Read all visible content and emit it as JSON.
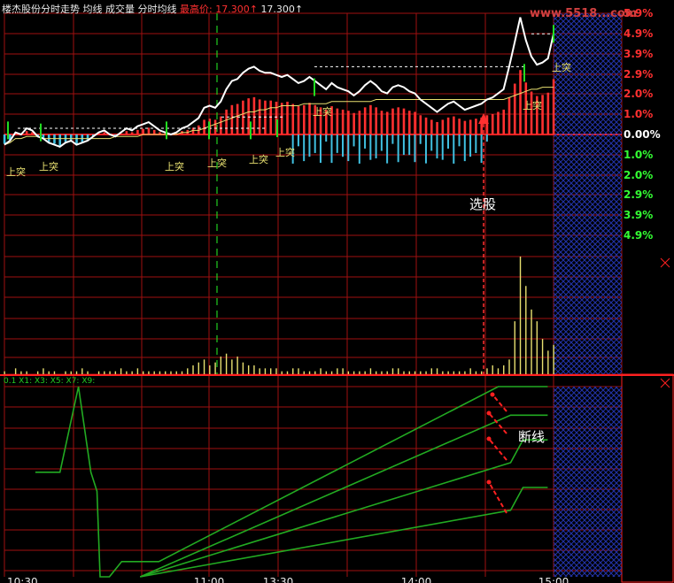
{
  "header": {
    "stock_name": "楼杰股份",
    "chart_title": "分时走势",
    "indicators": [
      "均线",
      "成交量",
      "分时均线"
    ],
    "high_label": "最高价:",
    "high_value": "17.300↑",
    "high_value2": "17.300↑"
  },
  "logo": {
    "text": "www.5518...com"
  },
  "sub_header": {
    "text": "0.1 X1: X3: X5: X7: X9:"
  },
  "annotations": {
    "select_stock": "选股",
    "break_line": "断线",
    "breakout": "上突"
  },
  "colors": {
    "background": "#000000",
    "grid": "#a01010",
    "price": "#ffffff",
    "avg": "#e8e070",
    "up": "#ff3030",
    "down": "#40c0e0",
    "indicator": "#22aa22",
    "volume": "#e8e070",
    "hatch": "#1a2a8a"
  },
  "chart_data": [
    {
      "type": "line",
      "name": "intraday-price",
      "y_ticks_up": [
        "5.9%",
        "4.9%",
        "3.9%",
        "2.9%",
        "2.0%",
        "1.0%"
      ],
      "y_tick_zero": "0.00%",
      "y_ticks_down": [
        "1.0%",
        "2.0%",
        "2.9%",
        "3.9%",
        "4.9%"
      ],
      "ylim": [
        -4.9,
        5.9
      ],
      "price_pct": [
        -0.5,
        -0.3,
        0.1,
        0.0,
        0.3,
        0.2,
        -0.1,
        -0.2,
        -0.4,
        -0.5,
        -0.6,
        -0.4,
        -0.3,
        -0.5,
        -0.4,
        -0.3,
        -0.1,
        0.1,
        0.2,
        0.0,
        -0.1,
        0.1,
        0.3,
        0.2,
        0.4,
        0.5,
        0.6,
        0.4,
        0.2,
        0.1,
        0.0,
        0.1,
        0.3,
        0.4,
        0.6,
        0.8,
        1.3,
        1.4,
        1.3,
        1.6,
        2.2,
        2.6,
        2.7,
        3.0,
        3.2,
        3.3,
        3.1,
        3.0,
        3.0,
        2.9,
        2.8,
        2.9,
        2.7,
        2.5,
        2.6,
        2.8,
        2.6,
        2.4,
        2.2,
        2.5,
        2.3,
        2.2,
        2.1,
        1.9,
        2.1,
        2.4,
        2.6,
        2.4,
        2.1,
        2.0,
        2.3,
        2.4,
        2.3,
        2.1,
        2.0,
        1.7,
        1.5,
        1.3,
        1.1,
        1.3,
        1.5,
        1.6,
        1.4,
        1.2,
        1.3,
        1.4,
        1.5,
        1.7,
        1.8,
        2.0,
        2.2,
        3.3,
        4.5,
        5.7,
        4.6,
        3.8,
        3.4,
        3.5,
        3.7,
        4.9
      ],
      "avg_pct": [
        -0.5,
        -0.4,
        -0.2,
        -0.2,
        -0.1,
        -0.1,
        -0.1,
        -0.2,
        -0.2,
        -0.2,
        -0.2,
        -0.2,
        -0.2,
        -0.2,
        -0.2,
        -0.2,
        -0.2,
        -0.2,
        -0.2,
        -0.2,
        -0.1,
        -0.1,
        -0.1,
        -0.1,
        -0.1,
        0.0,
        0.0,
        0.0,
        0.0,
        0.0,
        0.0,
        0.0,
        0.1,
        0.1,
        0.2,
        0.2,
        0.3,
        0.4,
        0.5,
        0.6,
        0.7,
        0.8,
        0.9,
        1.0,
        1.1,
        1.1,
        1.2,
        1.2,
        1.3,
        1.3,
        1.4,
        1.4,
        1.4,
        1.4,
        1.5,
        1.5,
        1.5,
        1.5,
        1.5,
        1.6,
        1.6,
        1.6,
        1.6,
        1.6,
        1.6,
        1.6,
        1.6,
        1.7,
        1.7,
        1.7,
        1.7,
        1.7,
        1.7,
        1.7,
        1.7,
        1.7,
        1.7,
        1.7,
        1.7,
        1.7,
        1.7,
        1.7,
        1.7,
        1.7,
        1.7,
        1.7,
        1.7,
        1.7,
        1.7,
        1.7,
        1.7,
        1.8,
        1.9,
        2.0,
        2.1,
        2.2,
        2.2,
        2.3,
        2.3,
        2.3
      ]
    },
    {
      "type": "bar",
      "name": "volume",
      "values": [
        1,
        0,
        2,
        1,
        1,
        0,
        1,
        2,
        1,
        1,
        0,
        1,
        1,
        1,
        2,
        1,
        0,
        1,
        1,
        1,
        1,
        2,
        1,
        1,
        2,
        1,
        1,
        1,
        1,
        1,
        1,
        1,
        1,
        2,
        3,
        4,
        5,
        3,
        4,
        6,
        7,
        5,
        6,
        4,
        3,
        3,
        2,
        2,
        2,
        2,
        1,
        1,
        2,
        2,
        1,
        1,
        1,
        2,
        1,
        1,
        2,
        2,
        1,
        1,
        1,
        1,
        2,
        1,
        1,
        1,
        2,
        2,
        1,
        1,
        1,
        1,
        1,
        2,
        2,
        1,
        1,
        1,
        1,
        1,
        2,
        1,
        1,
        2,
        3,
        2,
        3,
        5,
        18,
        40,
        30,
        22,
        18,
        12,
        8,
        10
      ]
    },
    {
      "type": "line",
      "name": "indicator",
      "x_labels": [
        "10:30",
        "11:00",
        "13:30",
        "14:00",
        "15:00"
      ],
      "series": [
        {
          "points": [
            [
              0.05,
              0.55
            ],
            [
              0.09,
              0.55
            ],
            [
              0.12,
              1.0
            ],
            [
              0.14,
              0.55
            ],
            [
              0.15,
              0.45
            ],
            [
              0.155,
              0.0
            ],
            [
              0.17,
              0.0
            ],
            [
              0.19,
              0.08
            ],
            [
              0.25,
              0.08
            ],
            [
              0.8,
              1.0
            ],
            [
              0.88,
              1.0
            ]
          ]
        },
        {
          "points": [
            [
              0.22,
              0.0
            ],
            [
              0.82,
              0.85
            ],
            [
              0.88,
              0.85
            ]
          ]
        },
        {
          "points": [
            [
              0.22,
              0.0
            ],
            [
              0.82,
              0.6
            ],
            [
              0.84,
              0.72
            ],
            [
              0.88,
              0.72
            ]
          ]
        },
        {
          "points": [
            [
              0.22,
              0.0
            ],
            [
              0.82,
              0.35
            ],
            [
              0.84,
              0.47
            ],
            [
              0.88,
              0.47
            ]
          ]
        }
      ]
    }
  ]
}
